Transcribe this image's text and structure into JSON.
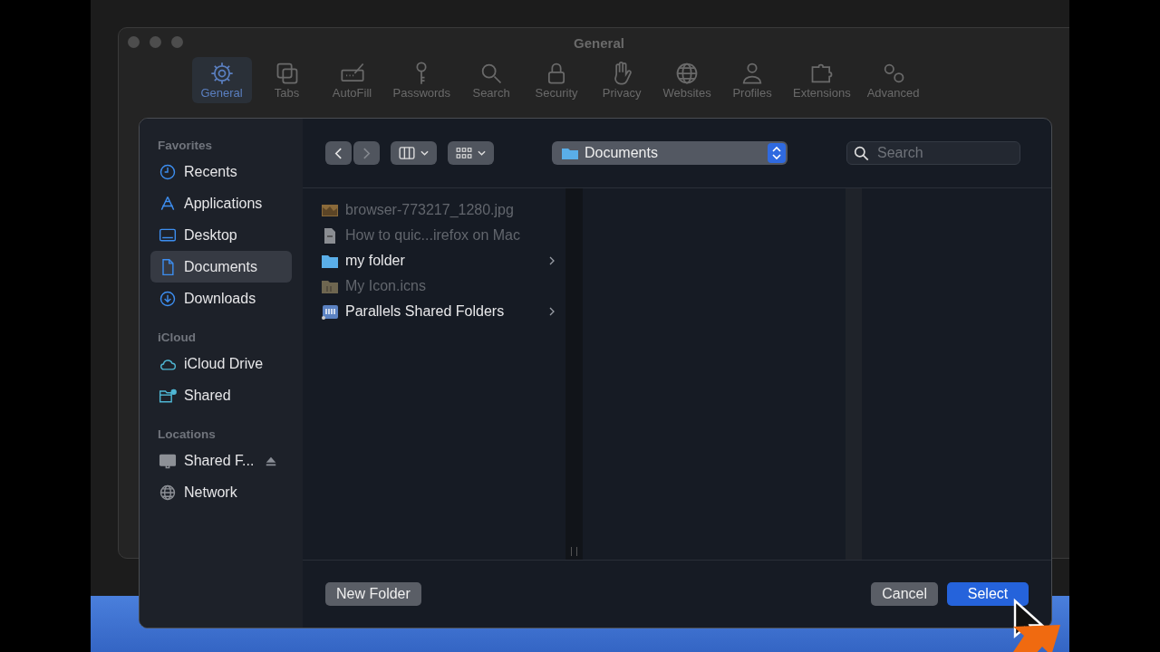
{
  "background_window": {
    "title": "General",
    "toolbar": [
      {
        "label": "General",
        "selected": true
      },
      {
        "label": "Tabs",
        "selected": false
      },
      {
        "label": "AutoFill",
        "selected": false
      },
      {
        "label": "Passwords",
        "selected": false
      },
      {
        "label": "Search",
        "selected": false
      },
      {
        "label": "Security",
        "selected": false
      },
      {
        "label": "Privacy",
        "selected": false
      },
      {
        "label": "Websites",
        "selected": false
      },
      {
        "label": "Profiles",
        "selected": false
      },
      {
        "label": "Extensions",
        "selected": false
      },
      {
        "label": "Advanced",
        "selected": false
      }
    ]
  },
  "dialog": {
    "sidebar": [
      {
        "heading": "Favorites",
        "items": [
          {
            "label": "Recents",
            "selected": false,
            "ejectable": false
          },
          {
            "label": "Applications",
            "selected": false,
            "ejectable": false
          },
          {
            "label": "Desktop",
            "selected": false,
            "ejectable": false
          },
          {
            "label": "Documents",
            "selected": true,
            "ejectable": false
          },
          {
            "label": "Downloads",
            "selected": false,
            "ejectable": false
          }
        ]
      },
      {
        "heading": "iCloud",
        "items": [
          {
            "label": "iCloud Drive",
            "selected": false,
            "ejectable": false
          },
          {
            "label": "Shared",
            "selected": false,
            "ejectable": false
          }
        ]
      },
      {
        "heading": "Locations",
        "items": [
          {
            "label": "Shared F...",
            "selected": false,
            "ejectable": true
          },
          {
            "label": "Network",
            "selected": false,
            "ejectable": false
          }
        ]
      }
    ],
    "navigation": [
      {
        "kind": "back",
        "disabled": false
      },
      {
        "kind": "forward",
        "disabled": true
      }
    ],
    "location": "Documents",
    "search": {
      "placeholder": "Search"
    },
    "files": [
      {
        "name": "browser-773217_1280.jpg",
        "kind": "image",
        "disabled": true,
        "has_children": false
      },
      {
        "name": "How to quic...irefox on Mac",
        "kind": "document",
        "disabled": true,
        "has_children": false
      },
      {
        "name": "my folder",
        "kind": "folder",
        "disabled": false,
        "has_children": true
      },
      {
        "name": "My Icon.icns",
        "kind": "icns",
        "disabled": true,
        "has_children": false
      },
      {
        "name": "Parallels Shared Folders",
        "kind": "shared",
        "disabled": false,
        "has_children": true
      }
    ],
    "buttons": [
      {
        "label": "New Folder",
        "kind": "secondary"
      },
      {
        "label": "Cancel",
        "kind": "secondary"
      },
      {
        "label": "Select",
        "kind": "primary"
      }
    ]
  }
}
